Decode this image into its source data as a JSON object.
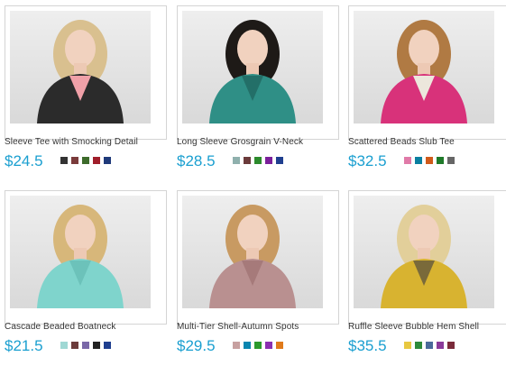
{
  "products": [
    {
      "name": "Sleeve Tee with Smocking Detail",
      "price": "$24.5",
      "garment": "#2b2b2b",
      "accent": "#f0a0a8",
      "hair": "#d9c08f",
      "swatches": [
        "#333333",
        "#7a3b3b",
        "#3d6b2b",
        "#a01e2a",
        "#1f3a7a"
      ]
    },
    {
      "name": "Long Sleeve Grosgrain V-Neck",
      "price": "$28.5",
      "garment": "#2f8f86",
      "accent": "#236f68",
      "hair": "#1e1a17",
      "swatches": [
        "#8fb0ad",
        "#6b3b3b",
        "#2c8a2c",
        "#7a1f9a",
        "#1f3f8f"
      ]
    },
    {
      "name": "Scattered Beads Slub Tee",
      "price": "$32.5",
      "garment": "#d8327a",
      "accent": "#ece7dc",
      "hair": "#b07a43",
      "swatches": [
        "#e07aa8",
        "#0a7fa0",
        "#d05a1a",
        "#1f7a2a",
        "#666666"
      ]
    },
    {
      "name": "Cascade Beaded Boatneck",
      "price": "$21.5",
      "garment": "#7fd4cc",
      "accent": "#6cc2ba",
      "hair": "#d7b77a",
      "swatches": [
        "#9fd8d4",
        "#6b3b3b",
        "#7a68a8",
        "#222222",
        "#1f3f8f"
      ]
    },
    {
      "name": "Multi-Tier Shell-Autumn Spots",
      "price": "$29.5",
      "garment": "#b99090",
      "accent": "#a67a7a",
      "hair": "#c89a62",
      "swatches": [
        "#c7a0a0",
        "#0a86b0",
        "#2c9a2c",
        "#8a2fb0",
        "#e07a1a"
      ]
    },
    {
      "name": "Ruffle Sleeve Bubble Hem Shell",
      "price": "$35.5",
      "garment": "#d8b330",
      "accent": "#7a6a3a",
      "hair": "#e2cf9a",
      "swatches": [
        "#e8c840",
        "#2c8a3a",
        "#4a6a9a",
        "#8a3a9a",
        "#7a2a3a"
      ]
    }
  ]
}
